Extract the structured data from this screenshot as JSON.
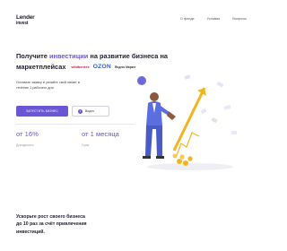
{
  "logo": {
    "line1": "Lender",
    "line2": "invest"
  },
  "nav": [
    "О фонде",
    "Условия",
    "Вопросы"
  ],
  "hero": {
    "headline_part1": "Получите ",
    "headline_accent": "инвестиции",
    "headline_part2": " на развитие бизнеса на маркетплейсах",
    "subtext": "Оставьте заявку и узнайте свой лимит в течение 1 рабочего дня",
    "primary_button": "Запустить бизнес",
    "secondary_button": "Видео"
  },
  "marketplaces": {
    "wildberries": "wildberries",
    "ozon": "OZON",
    "yandex": "Яндекс Маркет"
  },
  "stats": [
    {
      "value": "от 16%",
      "caption": "Доходность"
    },
    {
      "value": "от 1 месяца",
      "caption": "Срок"
    }
  ],
  "bottom": {
    "text": "Ускорьте рост своего бизнеса до 10 раз за счёт привлечения инвестиций."
  },
  "colors": {
    "accent": "#6b57d6",
    "text": "#1f1f2e",
    "ozon": "#2b5ee8",
    "wb": "#c2185b",
    "coin": "#f2b51e"
  }
}
